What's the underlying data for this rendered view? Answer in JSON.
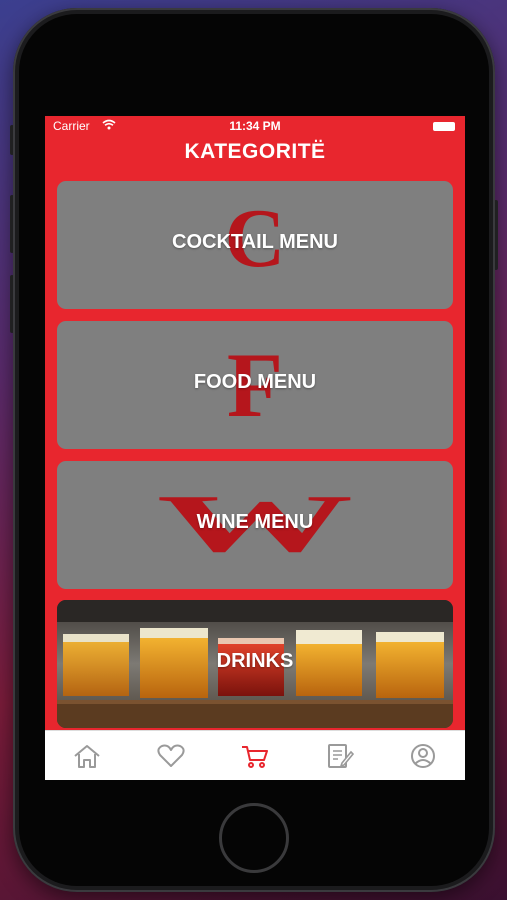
{
  "status_bar": {
    "carrier": "Carrier",
    "time": "11:34 PM"
  },
  "header": {
    "title": "KATEGORITË"
  },
  "categories": [
    {
      "label": "COCKTAIL MENU",
      "monogram": "C"
    },
    {
      "label": "FOOD MENU",
      "monogram": "F"
    },
    {
      "label": "WINE MENU",
      "monogram": "W"
    },
    {
      "label": "DRINKS",
      "image": "beer-flight-photo"
    }
  ],
  "tab_bar": {
    "items": [
      {
        "icon": "home-icon",
        "active": false
      },
      {
        "icon": "heart-icon",
        "active": false
      },
      {
        "icon": "cart-icon",
        "active": true
      },
      {
        "icon": "order-list-icon",
        "active": false
      },
      {
        "icon": "profile-icon",
        "active": false
      }
    ]
  },
  "colors": {
    "accent": "#e8262e",
    "card": "#7f7f7f",
    "monogram": "#b5161c",
    "tab_inactive": "#9a9a9a"
  }
}
